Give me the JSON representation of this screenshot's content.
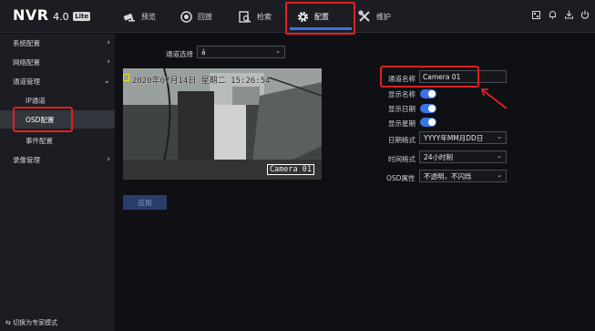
{
  "brand": {
    "name": "NVR",
    "version": "4.0",
    "edition": "Lite"
  },
  "nav": [
    {
      "label": "预览",
      "icon": "camera-icon"
    },
    {
      "label": "回放",
      "icon": "playback-icon"
    },
    {
      "label": "检索",
      "icon": "search-icon"
    },
    {
      "label": "配置",
      "icon": "gear-icon",
      "active": true
    },
    {
      "label": "维护",
      "icon": "tools-icon"
    }
  ],
  "sidebar": {
    "items": [
      {
        "label": "系统配置",
        "expandable": true
      },
      {
        "label": "网络配置",
        "expandable": true
      },
      {
        "label": "通道管理",
        "expandable": true,
        "expanded": true
      },
      {
        "label": "IP通道"
      },
      {
        "label": "OSD配置",
        "selected": true
      },
      {
        "label": "事件配置"
      },
      {
        "label": "录像管理",
        "expandable": true
      }
    ],
    "footer": "切换为专家模式"
  },
  "main": {
    "channel_select_label": "通道选择",
    "channel_select_value": "á",
    "preview": {
      "osd_datetime": "2020年07月14日 星期二 15:26:54",
      "osd_name": "Camera 01"
    },
    "form": {
      "channel_name_label": "通道名称",
      "channel_name_value": "Camera 01",
      "show_name_label": "显示名称",
      "show_date_label": "显示日期",
      "show_week_label": "显示星期",
      "date_format_label": "日期格式",
      "date_format_value": "YYYY年MM月DD日",
      "time_format_label": "时间格式",
      "time_format_value": "24小时制",
      "osd_attr_label": "OSD属性",
      "osd_attr_value": "不透明，不闪烁"
    },
    "apply_label": "应用"
  },
  "colors": {
    "accent": "#3a72e8",
    "highlight": "#e02020",
    "background": "#0f1013",
    "panel": "#1c1d22"
  }
}
